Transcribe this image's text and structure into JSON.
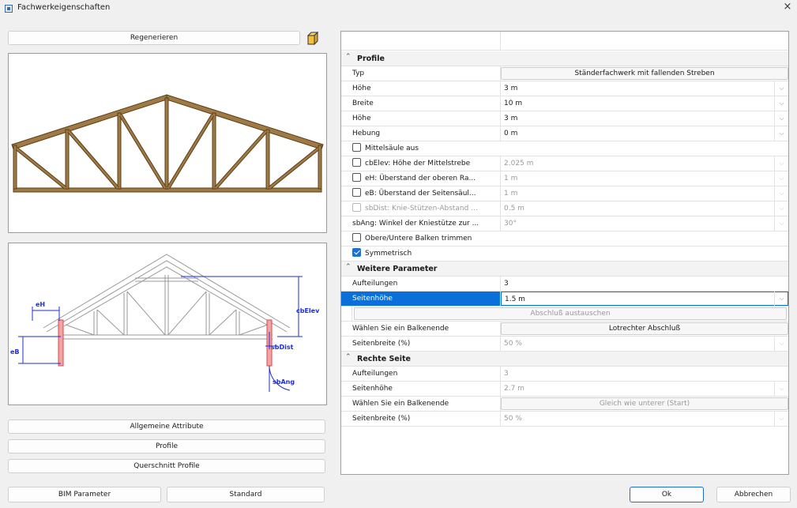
{
  "window": {
    "title": "Fachwerkeigenschaften",
    "close": "×"
  },
  "left": {
    "regenerate_label": "Regenerieren",
    "diagram_labels": {
      "eH": "eH",
      "eB": "eB",
      "cbElev": "cbElev",
      "sbDist": "sbDist",
      "sbAng": "sbAng"
    },
    "buttons": {
      "general_attributes": "Allgemeine Attribute",
      "profiles": "Profile",
      "cross_section_profiles": "Querschnitt Profile",
      "bim_parameters": "BIM Parameter",
      "standard": "Standard"
    }
  },
  "grid": {
    "sections": {
      "profile": "Profile",
      "further": "Weitere Parameter",
      "right": "Rechte Seite"
    },
    "rows": {
      "typ": {
        "label": "Typ",
        "value": "Ständerfachwerk mit fallenden Streben"
      },
      "hoehe1": {
        "label": "Höhe",
        "value": "3 m"
      },
      "breite": {
        "label": "Breite",
        "value": "10 m"
      },
      "hoehe2": {
        "label": "Höhe",
        "value": "3 m"
      },
      "hebung": {
        "label": "Hebung",
        "value": "0 m"
      },
      "mittelsaeule": {
        "label": "Mittelsäule aus"
      },
      "cbElev": {
        "label": "cbElev: Höhe der Mittelstrebe",
        "value": "2.025 m"
      },
      "eH": {
        "label": "eH: Überstand der oberen Ra...",
        "value": "1 m"
      },
      "eB": {
        "label": "eB: Überstand der Seitensäul...",
        "value": "1 m"
      },
      "sbDist": {
        "label": "sbDist: Knie-Stützen-Abstand ...",
        "value": "0.5 m"
      },
      "sbAng": {
        "label": "sbAng: Winkel der Kniestütze zur ...",
        "value": "30°"
      },
      "trim": {
        "label": "Obere/Untere Balken trimmen"
      },
      "symm": {
        "label": "Symmetrisch"
      },
      "aufteilungen": {
        "label": "Aufteilungen",
        "value": "3"
      },
      "seitenhoehe": {
        "label": "Seitenhöhe",
        "value": "1.5 m"
      },
      "abschluss": {
        "value": "Abschluß austauschen"
      },
      "balkenende": {
        "label": "Wählen Sie ein Balkenende",
        "value": "Lotrechter Abschluß"
      },
      "seitenbreite": {
        "label": "Seitenbreite (%)",
        "value": "50 %"
      },
      "r_aufteilungen": {
        "label": "Aufteilungen",
        "value": "3"
      },
      "r_seitenhoehe": {
        "label": "Seitenhöhe",
        "value": "2.7 m"
      },
      "r_balkenende": {
        "label": "Wählen Sie ein Balkenende",
        "value": "Gleich wie unterer (Start)"
      },
      "r_seitenbreite": {
        "label": "Seitenbreite (%)",
        "value": "50 %"
      }
    }
  },
  "footer": {
    "ok": "Ok",
    "cancel": "Abbrechen"
  },
  "colors": {
    "selection": "#0a6fd8",
    "wood": "#8b6a3e",
    "dimension": "#1d2fd6",
    "highlight": "#e88a8a"
  },
  "icons": {
    "dropdown": "⌵",
    "collapse": "⌃"
  }
}
